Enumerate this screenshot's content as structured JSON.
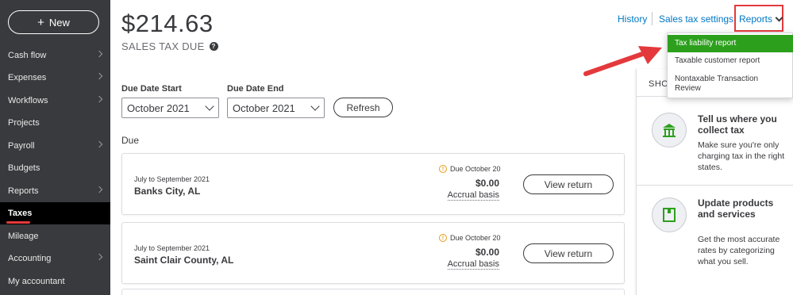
{
  "sidebar": {
    "new_label": "New",
    "items": [
      {
        "label": "Cash flow",
        "chevron": true
      },
      {
        "label": "Expenses",
        "chevron": true
      },
      {
        "label": "Workflows",
        "chevron": true
      },
      {
        "label": "Projects",
        "chevron": false
      },
      {
        "label": "Payroll",
        "chevron": true
      },
      {
        "label": "Budgets",
        "chevron": false
      },
      {
        "label": "Reports",
        "chevron": true
      },
      {
        "label": "Taxes",
        "chevron": false,
        "active": true
      },
      {
        "label": "Mileage",
        "chevron": false
      },
      {
        "label": "Accounting",
        "chevron": true
      },
      {
        "label": "My accountant",
        "chevron": false
      }
    ]
  },
  "header": {
    "amount": "$214.63",
    "due_label": "SALES TAX DUE",
    "help_icon": "question-circle-icon",
    "links": {
      "history": "History",
      "sales_tax_settings": "Sales tax settings",
      "reports": "Reports"
    }
  },
  "filters": {
    "start_label": "Due Date Start",
    "start_value": "October 2021",
    "end_label": "Due Date End",
    "end_value": "October 2021",
    "refresh_label": "Refresh"
  },
  "due_section": {
    "label": "Due",
    "cards": [
      {
        "period": "July to September 2021",
        "location": "Banks City, AL",
        "due_date": "Due October 20",
        "amount": "$0.00",
        "basis": "Accrual basis",
        "button": "View return"
      },
      {
        "period": "July to September 2021",
        "location": "Saint Clair County, AL",
        "due_date": "Due October 20",
        "amount": "$0.00",
        "basis": "Accrual basis",
        "button": "View return"
      }
    ]
  },
  "reports_dropdown": {
    "items": [
      {
        "label": "Tax liability report",
        "highlighted": true
      },
      {
        "label": "Taxable customer report",
        "highlighted": false
      },
      {
        "label": "Nontaxable Transaction Review",
        "highlighted": false
      }
    ]
  },
  "right_panel": {
    "header": "SHO",
    "tips": [
      {
        "icon": "building-icon",
        "title": "Tell us where you collect tax",
        "text": "Make sure you're only charging tax in the right states."
      },
      {
        "icon": "product-box-icon",
        "title": "Update products and services",
        "text": "Get the most accurate rates by categorizing what you sell."
      }
    ]
  },
  "colors": {
    "sidebar_bg": "#393a3d",
    "active_bg": "#000000",
    "active_underline": "#e4393c",
    "link": "#0077c5",
    "highlight_green": "#2ca01c",
    "annotation_red": "#e4393c",
    "warning": "#e89c1a"
  }
}
